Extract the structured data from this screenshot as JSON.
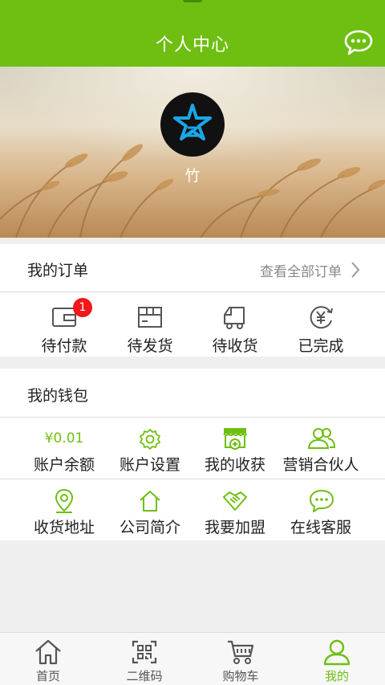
{
  "header": {
    "title": "个人中心",
    "chat_icon": "chat-bubble-icon"
  },
  "profile": {
    "username": "竹",
    "avatar_icon": "star-logo-icon"
  },
  "orders": {
    "title": "我的订单",
    "view_all": "查看全部订单",
    "items": [
      {
        "label": "待付款",
        "icon": "wallet-icon",
        "badge": "1"
      },
      {
        "label": "待发货",
        "icon": "box-icon"
      },
      {
        "label": "待收货",
        "icon": "truck-icon"
      },
      {
        "label": "已完成",
        "icon": "yen-refresh-icon"
      }
    ]
  },
  "wallet": {
    "title": "我的钱包",
    "items": [
      {
        "label": "账户余额",
        "value": "¥0.01"
      },
      {
        "label": "账户设置",
        "icon": "gear-icon"
      },
      {
        "label": "我的收获",
        "icon": "store-add-icon"
      },
      {
        "label": "营销合伙人",
        "icon": "users-icon"
      },
      {
        "label": "收货地址",
        "icon": "location-pin-icon"
      },
      {
        "label": "公司简介",
        "icon": "home-outline-icon"
      },
      {
        "label": "我要加盟",
        "icon": "handshake-icon"
      },
      {
        "label": "在线客服",
        "icon": "chat-dots-icon"
      }
    ]
  },
  "tabbar": {
    "items": [
      {
        "label": "首页",
        "icon": "home-icon"
      },
      {
        "label": "二维码",
        "icon": "qr-code-icon"
      },
      {
        "label": "购物车",
        "icon": "cart-icon"
      },
      {
        "label": "我的",
        "icon": "person-icon",
        "active": true
      }
    ]
  },
  "colors": {
    "brand": "#6fbf12",
    "badge": "#f01818"
  }
}
